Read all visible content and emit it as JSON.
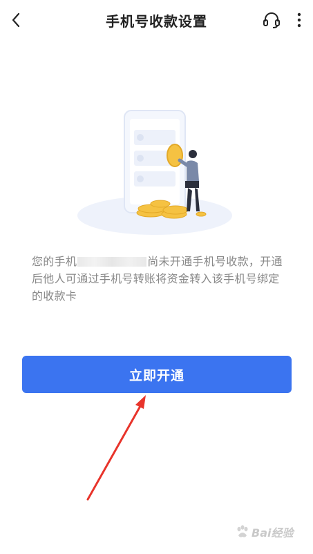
{
  "header": {
    "title": "手机号收款设置"
  },
  "icons": {
    "back": "chevron-left-icon",
    "headset": "headset-icon",
    "more": "more-vertical-icon"
  },
  "description": {
    "prefix": "您的手机",
    "suffix": "尚未开通手机号收款，开通后他人可通过手机号转账将资金转入该手机号绑定的收款卡"
  },
  "actions": {
    "open_label": "立即开通"
  },
  "watermark": {
    "text": "Bai经验"
  },
  "colors": {
    "primary_button": "#3b74f0",
    "annotation_arrow": "#e8342b",
    "coin_gold": "#f5c242"
  }
}
